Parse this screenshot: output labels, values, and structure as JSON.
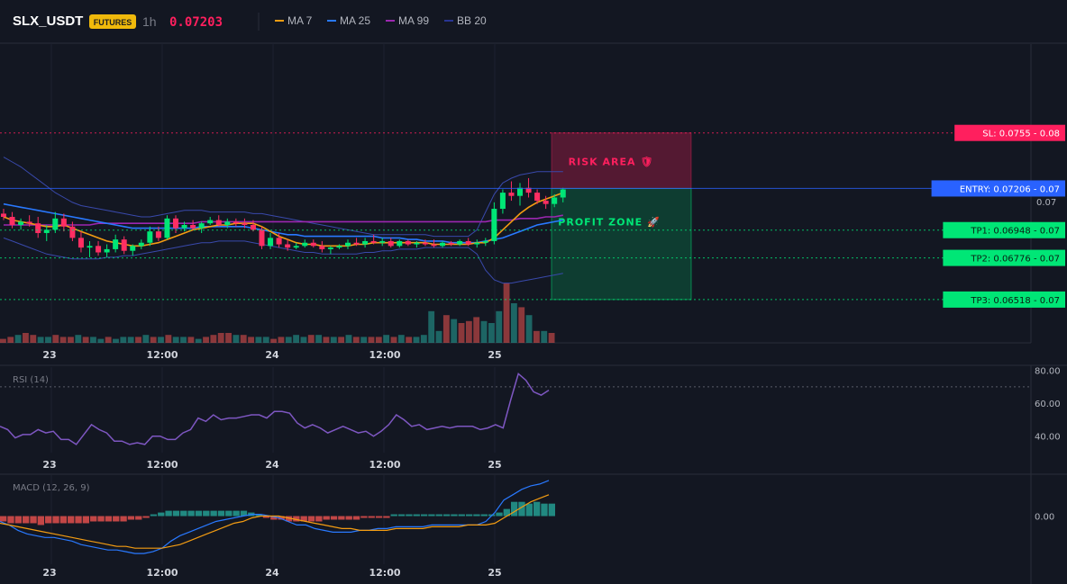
{
  "header": {
    "symbol": "SLX_USDT",
    "badge": "FUTURES",
    "interval": "1h",
    "price": "0.07203",
    "legend": [
      {
        "label": "MA 7",
        "color": "#f39c12"
      },
      {
        "label": "MA 25",
        "color": "#2979ff"
      },
      {
        "label": "MA 99",
        "color": "#9c27b0"
      },
      {
        "label": "BB 20",
        "color": "#283593"
      }
    ]
  },
  "colors": {
    "up": "#00e676",
    "down": "#ff2e63",
    "vol_up": "#26a69a",
    "vol_down": "#ef5350",
    "rsi": "#7e57c2",
    "macd": "#2979ff",
    "signal": "#f39c12"
  },
  "levels": {
    "sl": {
      "label": "SL: 0.0755 - 0.08",
      "value": 0.0755,
      "color": "#ff1f5e"
    },
    "entry": {
      "label": "ENTRY: 0.07206 - 0.07",
      "value": 0.07206,
      "color": "#2962ff"
    },
    "tp": [
      {
        "label": "TP1: 0.06948 - 0.07",
        "value": 0.06948,
        "color": "#00e676"
      },
      {
        "label": "TP2: 0.06776 - 0.07",
        "value": 0.06776,
        "color": "#00e676"
      },
      {
        "label": "TP3: 0.06518 - 0.07",
        "value": 0.06518,
        "color": "#00e676"
      }
    ]
  },
  "zones": {
    "risk": "RISK AREA 🛡",
    "profit": "PROFIT ZONE 🚀"
  },
  "chart_data": {
    "type": "candlestick",
    "price_axis_tick": "0.07",
    "x_ticks": [
      "23",
      "12:00",
      "24",
      "12:00",
      "25"
    ],
    "rsi": {
      "label": "RSI (14)",
      "ticks": [
        "80.00",
        "60.00",
        "40.00"
      ],
      "ylim": [
        30,
        82
      ],
      "values": [
        46,
        44,
        39,
        41,
        41,
        44,
        42,
        43,
        38,
        38,
        35,
        41,
        47,
        44,
        42,
        37,
        37,
        35,
        36,
        35,
        40,
        40,
        38,
        38,
        42,
        44,
        51,
        49,
        53,
        50,
        51,
        51,
        52,
        53,
        53,
        51,
        55,
        55,
        54,
        48,
        45,
        47,
        45,
        42,
        44,
        46,
        44,
        42,
        43,
        40,
        43,
        47,
        53,
        50,
        46,
        47,
        44,
        45,
        46,
        45,
        46,
        46,
        46,
        44,
        45,
        47,
        45,
        62,
        78,
        74,
        67,
        65,
        68
      ]
    },
    "macd": {
      "label": "MACD (12, 26, 9)",
      "ticks": [
        "0.00"
      ],
      "ylim": [
        -0.0027,
        0.0023
      ],
      "macd": [
        -0.0003,
        -0.0005,
        -0.0008,
        -0.001,
        -0.0011,
        -0.0012,
        -0.0012,
        -0.0013,
        -0.0014,
        -0.0016,
        -0.0017,
        -0.0018,
        -0.0019,
        -0.0019,
        -0.002,
        -0.0021,
        -0.0021,
        -0.002,
        -0.0018,
        -0.0014,
        -0.0011,
        -0.0009,
        -0.0007,
        -0.0005,
        -0.0003,
        -0.0002,
        -0.0001,
        0.0,
        0.0001,
        0.0001,
        0.0,
        -0.0001,
        -0.0003,
        -0.0005,
        -0.0005,
        -0.0007,
        -0.0008,
        -0.0009,
        -0.0009,
        -0.0009,
        -0.0008,
        -0.0008,
        -0.0007,
        -0.0007,
        -0.0006,
        -0.0006,
        -0.0006,
        -0.0006,
        -0.0005,
        -0.0005,
        -0.0005,
        -0.0005,
        -0.0005,
        -0.0005,
        -0.0003,
        0.0002,
        0.0009,
        0.0012,
        0.0015,
        0.0017,
        0.0018,
        0.002
      ],
      "signal": [
        -0.0004,
        -0.0005,
        -0.0006,
        -0.0007,
        -0.0008,
        -0.0009,
        -0.001,
        -0.0011,
        -0.0012,
        -0.0013,
        -0.0014,
        -0.0015,
        -0.0016,
        -0.0017,
        -0.0017,
        -0.0018,
        -0.0018,
        -0.0018,
        -0.0018,
        -0.0017,
        -0.0016,
        -0.0014,
        -0.0012,
        -0.001,
        -0.0008,
        -0.0006,
        -0.0004,
        -0.0003,
        -0.0001,
        0.0,
        0.0,
        0.0,
        -0.0001,
        -0.0002,
        -0.0003,
        -0.0004,
        -0.0005,
        -0.0006,
        -0.0007,
        -0.0007,
        -0.0008,
        -0.0008,
        -0.0008,
        -0.0008,
        -0.0007,
        -0.0007,
        -0.0007,
        -0.0007,
        -0.0006,
        -0.0006,
        -0.0006,
        -0.0006,
        -0.0005,
        -0.0005,
        -0.0005,
        -0.0004,
        -0.0001,
        0.0002,
        0.0005,
        0.0008,
        0.001,
        0.0012
      ],
      "hist": [
        -0.0003,
        -0.0004,
        -0.0004,
        -0.0004,
        -0.0004,
        -0.0005,
        -0.0004,
        -0.0004,
        -0.0004,
        -0.0004,
        -0.0004,
        -0.0004,
        -0.0003,
        -0.0003,
        -0.0003,
        -0.0003,
        -0.0003,
        -0.0002,
        -0.0002,
        -0.0001,
        0.0001,
        0.0002,
        0.0003,
        0.0003,
        0.0003,
        0.0003,
        0.0003,
        0.0003,
        0.0003,
        0.0003,
        0.0003,
        0.0003,
        0.0003,
        0.0002,
        0.0001,
        -0.0001,
        -0.0002,
        -0.0002,
        -0.0003,
        -0.0003,
        -0.0003,
        -0.0003,
        -0.0003,
        -0.0002,
        -0.0002,
        -0.0002,
        -0.0002,
        -0.0002,
        -0.0001,
        -0.0001,
        -0.0001,
        -0.0001,
        0.0001,
        0.0001,
        0.0001,
        0.0001,
        0.0001,
        0.0001,
        0.0001,
        0.0001,
        0.0001,
        0.0001,
        0.0001,
        0.0001,
        0.0001,
        0.0001,
        0.0002,
        0.0004,
        0.0008,
        0.0008,
        0.0007,
        0.0008,
        0.0007,
        0.0007
      ]
    },
    "price_ylim": [
      0.0625,
      0.081
    ],
    "candles": [
      [
        0.0705,
        0.0708,
        0.0701,
        0.0703
      ],
      [
        0.0703,
        0.0706,
        0.0696,
        0.0698
      ],
      [
        0.0698,
        0.0702,
        0.0695,
        0.07
      ],
      [
        0.07,
        0.0704,
        0.0697,
        0.0699
      ],
      [
        0.0699,
        0.0703,
        0.069,
        0.0693
      ],
      [
        0.0693,
        0.0698,
        0.0688,
        0.0695
      ],
      [
        0.0695,
        0.0706,
        0.0693,
        0.0702
      ],
      [
        0.0702,
        0.0705,
        0.0694,
        0.0697
      ],
      [
        0.0697,
        0.07,
        0.0688,
        0.069
      ],
      [
        0.069,
        0.0694,
        0.0681,
        0.0684
      ],
      [
        0.0684,
        0.0688,
        0.0678,
        0.0685
      ],
      [
        0.0685,
        0.0688,
        0.0679,
        0.0681
      ],
      [
        0.0681,
        0.0686,
        0.0678,
        0.0683
      ],
      [
        0.0683,
        0.0692,
        0.0681,
        0.0689
      ],
      [
        0.0689,
        0.0691,
        0.068,
        0.0682
      ],
      [
        0.0682,
        0.0686,
        0.0679,
        0.0685
      ],
      [
        0.0685,
        0.0689,
        0.0683,
        0.0687
      ],
      [
        0.0687,
        0.0697,
        0.0685,
        0.0694
      ],
      [
        0.0694,
        0.0697,
        0.0688,
        0.069
      ],
      [
        0.069,
        0.0704,
        0.0689,
        0.0702
      ],
      [
        0.0702,
        0.0704,
        0.0693,
        0.0696
      ],
      [
        0.0696,
        0.07,
        0.0694,
        0.0698
      ],
      [
        0.0698,
        0.0701,
        0.0695,
        0.0696
      ],
      [
        0.0696,
        0.07,
        0.0693,
        0.0699
      ],
      [
        0.0699,
        0.0703,
        0.0698,
        0.0701
      ],
      [
        0.0701,
        0.0704,
        0.0697,
        0.0698
      ],
      [
        0.0698,
        0.0702,
        0.0696,
        0.07
      ],
      [
        0.07,
        0.0702,
        0.0697,
        0.0699
      ],
      [
        0.0699,
        0.0702,
        0.0696,
        0.0698
      ],
      [
        0.0698,
        0.0701,
        0.0694,
        0.0695
      ],
      [
        0.0695,
        0.0697,
        0.0683,
        0.0685
      ],
      [
        0.0685,
        0.0693,
        0.0683,
        0.069
      ],
      [
        0.069,
        0.0693,
        0.0684,
        0.0686
      ],
      [
        0.0686,
        0.0689,
        0.0682,
        0.0684
      ],
      [
        0.0684,
        0.0687,
        0.0683,
        0.0685
      ],
      [
        0.0685,
        0.0689,
        0.0684,
        0.0687
      ],
      [
        0.0687,
        0.0689,
        0.0684,
        0.0685
      ],
      [
        0.0685,
        0.0688,
        0.0681,
        0.0683
      ],
      [
        0.0683,
        0.0685,
        0.068,
        0.0684
      ],
      [
        0.0684,
        0.0686,
        0.0683,
        0.0685
      ],
      [
        0.0685,
        0.0689,
        0.0683,
        0.0687
      ],
      [
        0.0687,
        0.069,
        0.0685,
        0.0686
      ],
      [
        0.0686,
        0.069,
        0.0684,
        0.0688
      ],
      [
        0.0688,
        0.0692,
        0.0686,
        0.0687
      ],
      [
        0.0687,
        0.069,
        0.0685,
        0.0688
      ],
      [
        0.0688,
        0.069,
        0.0684,
        0.0685
      ],
      [
        0.0685,
        0.0689,
        0.0684,
        0.0688
      ],
      [
        0.0688,
        0.0689,
        0.0685,
        0.0686
      ],
      [
        0.0686,
        0.0688,
        0.0684,
        0.0687
      ],
      [
        0.0687,
        0.0689,
        0.0685,
        0.0686
      ],
      [
        0.0686,
        0.0689,
        0.0684,
        0.0685
      ],
      [
        0.0685,
        0.0688,
        0.0684,
        0.0687
      ],
      [
        0.0687,
        0.0688,
        0.0685,
        0.0686
      ],
      [
        0.0686,
        0.0689,
        0.0685,
        0.0688
      ],
      [
        0.0688,
        0.069,
        0.0685,
        0.0686
      ],
      [
        0.0686,
        0.0689,
        0.0684,
        0.0687
      ],
      [
        0.0687,
        0.069,
        0.0685,
        0.0688
      ],
      [
        0.0688,
        0.0712,
        0.0686,
        0.0708
      ],
      [
        0.0708,
        0.072,
        0.0705,
        0.0718
      ],
      [
        0.0718,
        0.0725,
        0.0713,
        0.0716
      ],
      [
        0.0716,
        0.0724,
        0.071,
        0.0721
      ],
      [
        0.0721,
        0.0727,
        0.0715,
        0.0718
      ],
      [
        0.0718,
        0.072,
        0.0711,
        0.0713
      ],
      [
        0.0713,
        0.0716,
        0.0708,
        0.0711
      ],
      [
        0.0711,
        0.0717,
        0.0709,
        0.0715
      ],
      [
        0.0715,
        0.0721,
        0.0712,
        0.072
      ]
    ],
    "volumes": [
      2,
      3,
      4,
      5,
      4,
      3,
      3,
      4,
      3,
      3,
      4,
      3,
      3,
      2,
      3,
      2,
      3,
      3,
      3,
      4,
      3,
      3,
      4,
      3,
      3,
      3,
      2,
      3,
      4,
      5,
      5,
      4,
      4,
      3,
      3,
      3,
      2,
      3,
      3,
      4,
      3,
      4,
      4,
      3,
      3,
      3,
      4,
      3,
      3,
      3,
      3,
      4,
      3,
      4,
      3,
      3,
      4,
      16,
      6,
      14,
      12,
      10,
      11,
      13,
      11,
      10,
      16,
      30,
      20,
      18,
      14,
      6,
      6,
      5
    ],
    "ma7": [
      0.0703,
      0.0701,
      0.07,
      0.0699,
      0.0698,
      0.0697,
      0.0697,
      0.0698,
      0.0696,
      0.0694,
      0.0692,
      0.069,
      0.0688,
      0.0687,
      0.0686,
      0.0685,
      0.0685,
      0.0686,
      0.0687,
      0.0689,
      0.0691,
      0.0693,
      0.0695,
      0.0696,
      0.0697,
      0.0698,
      0.0698,
      0.0699,
      0.0699,
      0.0699,
      0.0697,
      0.0694,
      0.0691,
      0.0689,
      0.0687,
      0.0686,
      0.0686,
      0.0685,
      0.0685,
      0.0685,
      0.0685,
      0.0686,
      0.0686,
      0.0687,
      0.0687,
      0.0687,
      0.0687,
      0.0687,
      0.0687,
      0.0687,
      0.0686,
      0.0686,
      0.0686,
      0.0686,
      0.0686,
      0.0687,
      0.0687,
      0.069,
      0.0695,
      0.07,
      0.0705,
      0.0709,
      0.0712,
      0.0714,
      0.0716,
      0.0718
    ],
    "ma25": [
      0.0711,
      0.071,
      0.0709,
      0.0708,
      0.0707,
      0.0706,
      0.0705,
      0.0704,
      0.0703,
      0.0702,
      0.0701,
      0.07,
      0.0699,
      0.0698,
      0.0697,
      0.0696,
      0.0696,
      0.0696,
      0.0696,
      0.0696,
      0.0696,
      0.0696,
      0.0696,
      0.0697,
      0.0697,
      0.0697,
      0.0697,
      0.0697,
      0.0697,
      0.0696,
      0.0695,
      0.0694,
      0.0693,
      0.0692,
      0.0692,
      0.0691,
      0.0691,
      0.0691,
      0.0691,
      0.0691,
      0.0691,
      0.0691,
      0.0691,
      0.0691,
      0.069,
      0.069,
      0.069,
      0.0689,
      0.0689,
      0.0688,
      0.0688,
      0.0688,
      0.0687,
      0.0687,
      0.0687,
      0.0687,
      0.0688,
      0.0689,
      0.069,
      0.0692,
      0.0694,
      0.0696,
      0.0698,
      0.0699,
      0.07,
      0.0701
    ],
    "ma99": [
      0.0698,
      0.0698,
      0.0698,
      0.0698,
      0.0698,
      0.0698,
      0.0698,
      0.0698,
      0.0698,
      0.0698,
      0.0698,
      0.0699,
      0.0699,
      0.0699,
      0.0699,
      0.0699,
      0.0699,
      0.0699,
      0.0699,
      0.0699,
      0.0699,
      0.0699,
      0.0699,
      0.07,
      0.07,
      0.07,
      0.07,
      0.07,
      0.07,
      0.07,
      0.07,
      0.07,
      0.07,
      0.07,
      0.07,
      0.07,
      0.07,
      0.07,
      0.07,
      0.07,
      0.07,
      0.07,
      0.07,
      0.07,
      0.07,
      0.07,
      0.07,
      0.07,
      0.07,
      0.07,
      0.07,
      0.07,
      0.07,
      0.07,
      0.07,
      0.07,
      0.07,
      0.0701,
      0.0701,
      0.0701,
      0.0702,
      0.0702,
      0.0702,
      0.0703,
      0.0703,
      0.0704
    ],
    "bb_upper": [
      0.074,
      0.0737,
      0.0734,
      0.073,
      0.0726,
      0.0722,
      0.0718,
      0.0715,
      0.0712,
      0.071,
      0.0709,
      0.0708,
      0.0707,
      0.0706,
      0.0705,
      0.0704,
      0.0703,
      0.0703,
      0.0704,
      0.0705,
      0.0706,
      0.0707,
      0.0707,
      0.0707,
      0.0706,
      0.0706,
      0.0706,
      0.0706,
      0.0706,
      0.0705,
      0.0705,
      0.0704,
      0.0703,
      0.0702,
      0.0701,
      0.07,
      0.0699,
      0.0698,
      0.0697,
      0.0696,
      0.0695,
      0.0694,
      0.0693,
      0.0692,
      0.0692,
      0.0692,
      0.0692,
      0.0692,
      0.0692,
      0.0692,
      0.0691,
      0.0691,
      0.0691,
      0.0691,
      0.0691,
      0.0695,
      0.0706,
      0.0717,
      0.0724,
      0.0727,
      0.0729,
      0.073,
      0.0731,
      0.0731,
      0.0731,
      0.0731
    ],
    "bb_lower": [
      0.069,
      0.0688,
      0.0686,
      0.0684,
      0.0682,
      0.068,
      0.0679,
      0.0678,
      0.0677,
      0.0677,
      0.0677,
      0.0677,
      0.0678,
      0.0678,
      0.0679,
      0.0679,
      0.068,
      0.0681,
      0.0682,
      0.0683,
      0.0684,
      0.0685,
      0.0686,
      0.0687,
      0.0687,
      0.0688,
      0.0688,
      0.0688,
      0.0688,
      0.0687,
      0.0686,
      0.0685,
      0.0684,
      0.0683,
      0.0682,
      0.0681,
      0.0681,
      0.068,
      0.068,
      0.068,
      0.068,
      0.068,
      0.0681,
      0.0681,
      0.0682,
      0.0682,
      0.0683,
      0.0683,
      0.0683,
      0.0684,
      0.0684,
      0.0684,
      0.0684,
      0.0684,
      0.0684,
      0.068,
      0.067,
      0.0664,
      0.0662,
      0.0662,
      0.0663,
      0.0664,
      0.0665,
      0.0666,
      0.0667,
      0.0668
    ]
  }
}
